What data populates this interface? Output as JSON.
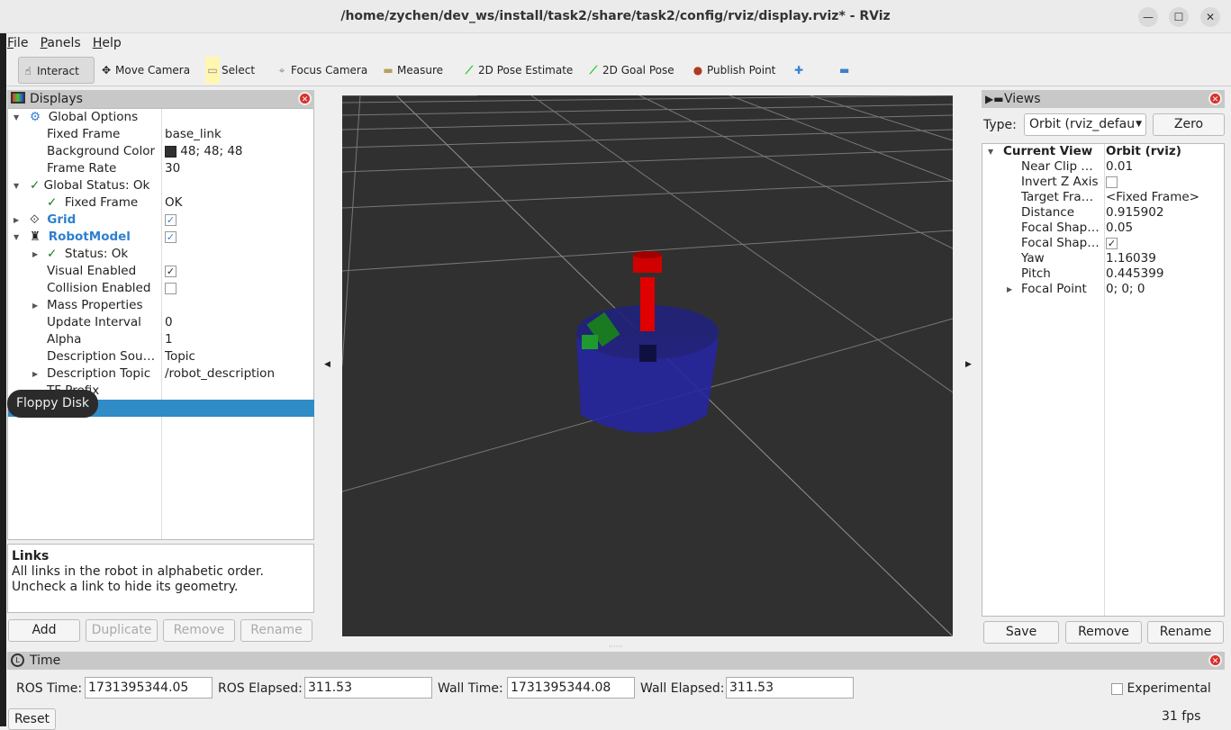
{
  "window": {
    "title": "/home/zychen/dev_ws/install/task2/share/task2/config/rviz/display.rviz* - RViz",
    "minimize": "—",
    "maximize": "☐",
    "close": "✕"
  },
  "menu": [
    {
      "label": "File",
      "u": "F",
      "rest": "ile"
    },
    {
      "label": "Panels",
      "u": "P",
      "rest": "anels"
    },
    {
      "label": "Help",
      "u": "H",
      "rest": "elp"
    }
  ],
  "toolbar": {
    "tools": [
      {
        "label": "Interact",
        "icon": "hand-icon",
        "glyph": "☝",
        "active": true
      },
      {
        "label": "Move Camera",
        "icon": "move-camera-icon",
        "glyph": "✥"
      },
      {
        "label": "Select",
        "icon": "select-icon",
        "glyph": "▭"
      },
      {
        "label": "Focus Camera",
        "icon": "focus-camera-icon",
        "glyph": "⌖"
      },
      {
        "label": "Measure",
        "icon": "ruler-icon",
        "glyph": "▬"
      },
      {
        "label": "2D Pose Estimate",
        "icon": "pose-arrow-icon",
        "glyph": "⟋"
      },
      {
        "label": "2D Goal Pose",
        "icon": "goal-arrow-icon",
        "glyph": "⟋"
      },
      {
        "label": "Publish Point",
        "icon": "map-pin-icon",
        "glyph": "●"
      }
    ],
    "add_glyph": "✚",
    "remove_glyph": "▬"
  },
  "displays": {
    "title": "Displays",
    "rows": [
      {
        "label": "Global Options",
        "value": ""
      },
      {
        "label": "Fixed Frame",
        "value": "base_link"
      },
      {
        "label": "Background Color",
        "value": "48; 48; 48"
      },
      {
        "label": "Frame Rate",
        "value": "30"
      },
      {
        "label": "Global Status: Ok",
        "value": ""
      },
      {
        "label": "Fixed Frame",
        "value": "OK"
      },
      {
        "label": "Grid",
        "value": ""
      },
      {
        "label": "RobotModel",
        "value": ""
      },
      {
        "label": "Status: Ok",
        "value": ""
      },
      {
        "label": "Visual Enabled",
        "value": ""
      },
      {
        "label": "Collision Enabled",
        "value": ""
      },
      {
        "label": "Mass Properties",
        "value": ""
      },
      {
        "label": "Update Interval",
        "value": "0"
      },
      {
        "label": "Alpha",
        "value": "1"
      },
      {
        "label": "Description Sou…",
        "value": "Topic"
      },
      {
        "label": "Description Topic",
        "value": "/robot_description"
      },
      {
        "label": "TF Prefix",
        "value": ""
      }
    ],
    "background_color": "#303030",
    "tooltip": "Floppy Disk",
    "help_title": "Links",
    "help_text": "All links in the robot in alphabetic order. Uncheck a link to hide its geometry.",
    "buttons": {
      "add": "Add",
      "duplicate": "Duplicate",
      "remove": "Remove",
      "rename": "Rename"
    }
  },
  "views": {
    "title": "Views",
    "type_label": "Type:",
    "type_value": "Orbit (rviz_defaul",
    "zero": "Zero",
    "rows": [
      {
        "label": "Current View",
        "value": "Orbit (rviz)"
      },
      {
        "label": "Near Clip …",
        "value": "0.01"
      },
      {
        "label": "Invert Z Axis",
        "value": ""
      },
      {
        "label": "Target Fra…",
        "value": "<Fixed Frame>"
      },
      {
        "label": "Distance",
        "value": "0.915902"
      },
      {
        "label": "Focal Shap…",
        "value": "0.05"
      },
      {
        "label": "Focal Shap…",
        "value": ""
      },
      {
        "label": "Yaw",
        "value": "1.16039"
      },
      {
        "label": "Pitch",
        "value": "0.445399"
      },
      {
        "label": "Focal Point",
        "value": "0; 0; 0"
      }
    ],
    "buttons": {
      "save": "Save",
      "remove": "Remove",
      "rename": "Rename"
    }
  },
  "time": {
    "title": "Time",
    "ros_time_label": "ROS Time:",
    "ros_time": "1731395344.05",
    "ros_elapsed_label": "ROS Elapsed:",
    "ros_elapsed": "311.53",
    "wall_time_label": "Wall Time:",
    "wall_time": "1731395344.08",
    "wall_elapsed_label": "Wall Elapsed:",
    "wall_elapsed": "311.53",
    "experimental": "Experimental",
    "reset": "Reset",
    "fps": "31 fps"
  },
  "colors": {
    "viewport_bg": "#303030",
    "selection": "#308cc6",
    "robot_body": "#2a2a9a",
    "robot_post": "#e00000",
    "robot_arm": "#1a8a2a"
  }
}
